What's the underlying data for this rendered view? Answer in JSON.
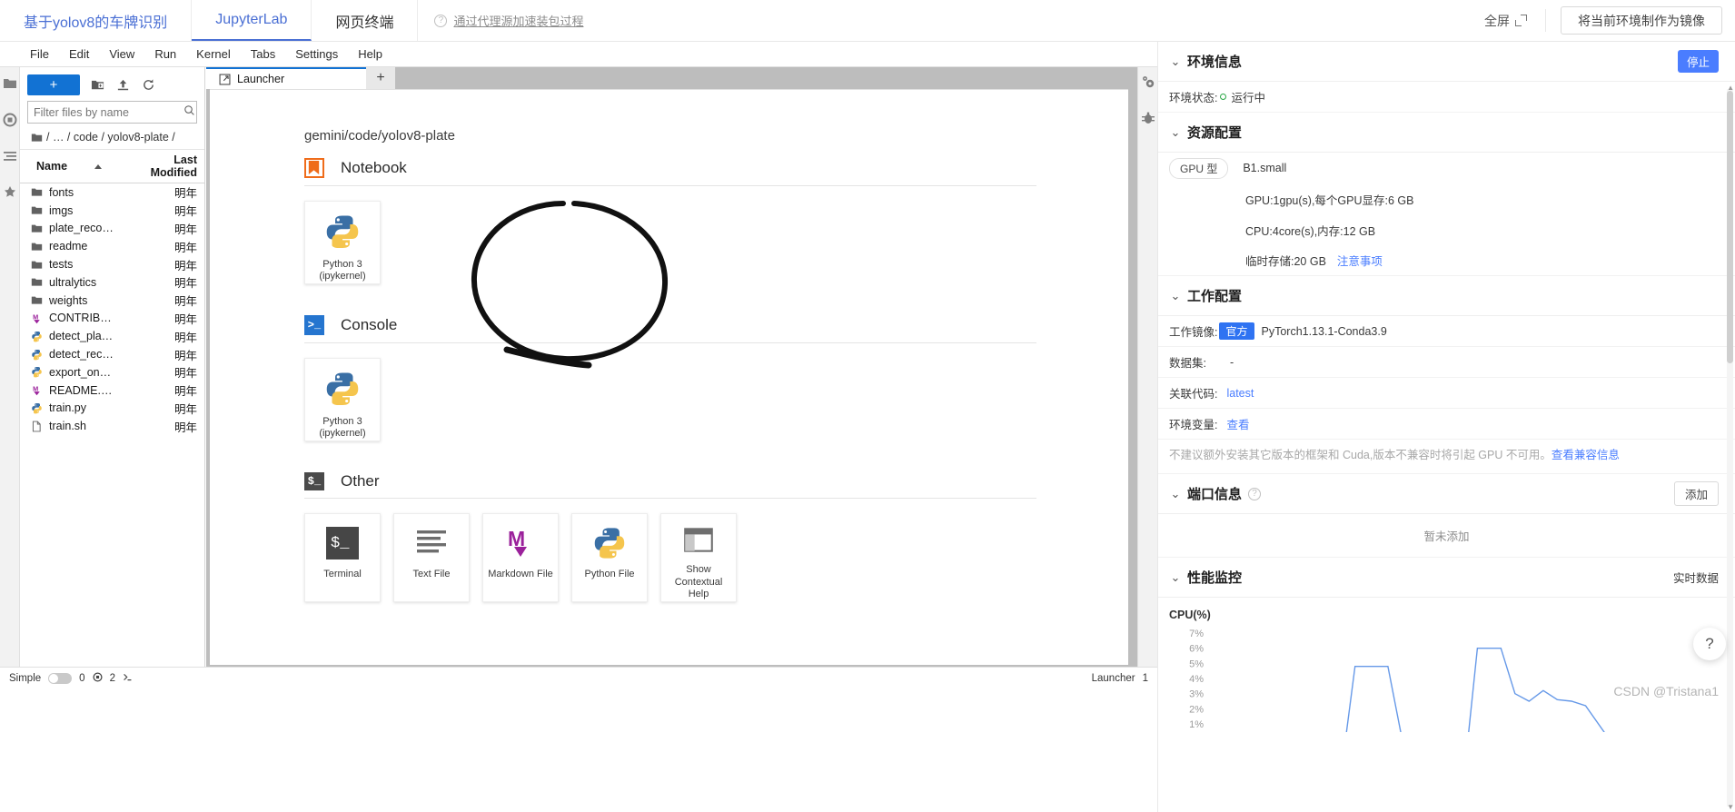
{
  "topbar": {
    "project_tab": "基于yolov8的车牌识别",
    "jupyter_tab": "JupyterLab",
    "terminal_tab": "网页终端",
    "proxy_note": "通过代理源加速装包过程",
    "fullscreen": "全屏",
    "make_image_button": "将当前环境制作为镜像"
  },
  "menubar": {
    "items": [
      "File",
      "Edit",
      "View",
      "Run",
      "Kernel",
      "Tabs",
      "Settings",
      "Help"
    ]
  },
  "filebrowser": {
    "new_button": "+",
    "new_folder_icon": "new-folder-icon",
    "upload_icon": "upload-icon",
    "refresh_icon": "refresh-icon",
    "filter_placeholder": "Filter files by name",
    "filter_value": "",
    "search_icon": "search-icon",
    "breadcrumb": "/ … / code / yolov8-plate /",
    "columns": [
      "Name",
      "Last Modified"
    ],
    "rows": [
      {
        "name": "fonts",
        "modified": "明年",
        "kind": "folder"
      },
      {
        "name": "imgs",
        "modified": "明年",
        "kind": "folder"
      },
      {
        "name": "plate_reco…",
        "modified": "明年",
        "kind": "folder"
      },
      {
        "name": "readme",
        "modified": "明年",
        "kind": "folder"
      },
      {
        "name": "tests",
        "modified": "明年",
        "kind": "folder"
      },
      {
        "name": "ultralytics",
        "modified": "明年",
        "kind": "folder"
      },
      {
        "name": "weights",
        "modified": "明年",
        "kind": "folder"
      },
      {
        "name": "CONTRIB…",
        "modified": "明年",
        "kind": "markdown"
      },
      {
        "name": "detect_pla…",
        "modified": "明年",
        "kind": "python"
      },
      {
        "name": "detect_rec…",
        "modified": "明年",
        "kind": "python"
      },
      {
        "name": "export_on…",
        "modified": "明年",
        "kind": "python"
      },
      {
        "name": "README.…",
        "modified": "明年",
        "kind": "markdown"
      },
      {
        "name": "train.py",
        "modified": "明年",
        "kind": "python"
      },
      {
        "name": "train.sh",
        "modified": "明年",
        "kind": "file"
      }
    ]
  },
  "dock": {
    "tab_label": "Launcher",
    "tab_icon": "launcher-icon",
    "add_tab": "+"
  },
  "launcher": {
    "path": "gemini/code/yolov8-plate",
    "sections": [
      {
        "title": "Notebook",
        "icon": "notebook-icon",
        "cards": [
          {
            "label": "Python 3\n(ipykernel)",
            "label_line1": "Python 3",
            "label_line2": "(ipykernel)",
            "icon": "python-icon"
          }
        ]
      },
      {
        "title": "Console",
        "icon": "console-icon",
        "cards": [
          {
            "label_line1": "Python 3",
            "label_line2": "(ipykernel)",
            "icon": "python-icon"
          }
        ]
      },
      {
        "title": "Other",
        "icon": "other-icon",
        "cards": [
          {
            "label_line1": "Terminal",
            "label_line2": "",
            "icon": "terminal-icon"
          },
          {
            "label_line1": "Text File",
            "label_line2": "",
            "icon": "text-file-icon"
          },
          {
            "label_line1": "Markdown File",
            "label_line2": "",
            "icon": "markdown-icon"
          },
          {
            "label_line1": "Python File",
            "label_line2": "",
            "icon": "python-icon"
          },
          {
            "label_line1": "Show",
            "label_line2": "Contextual",
            "label_line3": "Help",
            "icon": "contextual-help-icon"
          }
        ]
      }
    ]
  },
  "rightpanel": {
    "env_info": {
      "title": "环境信息",
      "stop_button": "停止",
      "status_label": "环境状态:",
      "status_value": "运行中"
    },
    "resources": {
      "title": "资源配置",
      "gpu_pill": "GPU 型",
      "flavor": "B1.small",
      "gpu_line": "GPU:1gpu(s),每个GPU显存:6 GB",
      "cpu_line": "CPU:4core(s),内存:12 GB",
      "storage_line": "临时存储:20 GB",
      "storage_note_link": "注意事项"
    },
    "workspace": {
      "title": "工作配置",
      "image_label": "工作镜像:",
      "image_tag": "官方",
      "image_value": "PyTorch1.13.1-Conda3.9",
      "dataset_label": "数据集:",
      "dataset_value": "-",
      "code_label": "关联代码:",
      "code_value": "latest",
      "env_label": "环境变量:",
      "env_value": "查看",
      "warning_text": "不建议额外安装其它版本的框架和 Cuda,版本不兼容时将引起 GPU 不可用。",
      "warning_link": "查看兼容信息"
    },
    "ports": {
      "title": "端口信息",
      "help_icon": "help-circle-icon",
      "add_button": "添加",
      "empty_text": "暂未添加"
    },
    "monitor": {
      "title": "性能监控",
      "realtime_label": "实时数据"
    },
    "help_fab": "?",
    "watermark": "CSDN @Tristana1"
  },
  "chart_data": {
    "type": "line",
    "title": "CPU(%)",
    "ylabel": "%",
    "xlabel": "",
    "ylim": [
      0,
      7
    ],
    "yticks": [
      "7%",
      "6%",
      "5%",
      "4%",
      "3%",
      "2%",
      "1%"
    ],
    "grid": false,
    "legend": "none",
    "series": [
      {
        "name": "CPU",
        "color": "#6699e8",
        "x": [
          0,
          6,
          12,
          18,
          24,
          26,
          28,
          30,
          33,
          36,
          39,
          45,
          50,
          52,
          54,
          57,
          60,
          63,
          66,
          69,
          72,
          75,
          80,
          86,
          92,
          100
        ],
        "values": [
          0,
          0,
          0,
          0,
          0,
          4.8,
          4.8,
          4.8,
          4.8,
          0,
          0,
          0,
          0,
          6.0,
          6.0,
          6.0,
          3.0,
          2.5,
          3.2,
          2.6,
          2.5,
          2.2,
          0,
          0,
          0,
          0
        ]
      }
    ]
  },
  "statusbar": {
    "simple_label": "Simple",
    "kernel_count": "0",
    "terminal_count": "2",
    "launcher_label": "Launcher",
    "launcher_count": "1"
  }
}
